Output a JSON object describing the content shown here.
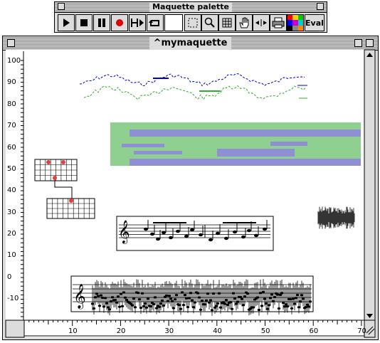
{
  "palette": {
    "title": "Maquette palette",
    "eval_label": "Eval",
    "buttons": [
      "play",
      "stop",
      "pause",
      "record",
      "play-to-marker",
      "loop",
      "blank",
      "select",
      "zoom",
      "grid",
      "hand",
      "spread",
      "print",
      "colors",
      "eval"
    ]
  },
  "window": {
    "title": "^mymaquette"
  },
  "axes": {
    "y_ticks": [
      "100",
      "90",
      "80",
      "70",
      "60",
      "50",
      "40",
      "30",
      "20",
      "10",
      "0",
      "-10"
    ],
    "x_ticks": [
      "10",
      "20",
      "30",
      "40",
      "50",
      "60",
      "70"
    ]
  },
  "colors": {
    "accent_blue": "#0000cc",
    "accent_green": "#33aa33",
    "block_green": "#8fcf8f",
    "block_purple": "#8f8fd6",
    "record_red": "#dd0000"
  }
}
